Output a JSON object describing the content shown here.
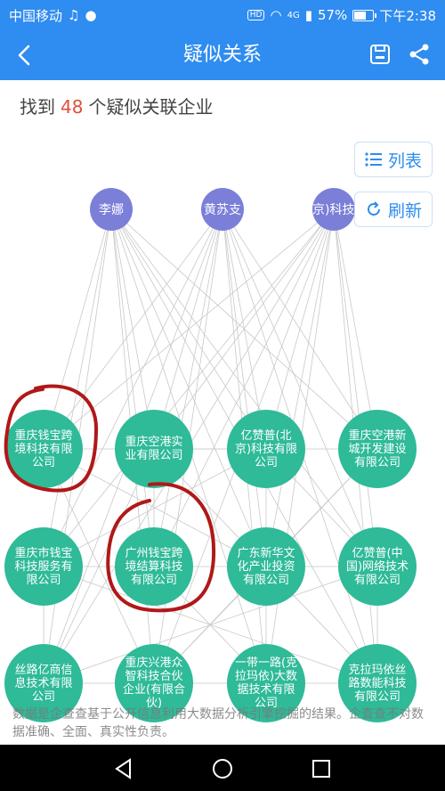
{
  "status": {
    "carrier": "中国移动",
    "signal": "4G",
    "battery": "57%",
    "battery_level": 0.57,
    "time": "下午2:38"
  },
  "header": {
    "title": "疑似关系",
    "icons": [
      "back-icon",
      "save-icon",
      "share-icon"
    ]
  },
  "summary": {
    "prefix": "找到",
    "count": "48",
    "suffix": "个疑似关联企业"
  },
  "toolbar": {
    "list_label": "列表",
    "refresh_label": "刷新"
  },
  "people": [
    {
      "name": "李娜"
    },
    {
      "name": "黄苏支"
    },
    {
      "name": "京)科技有"
    }
  ],
  "companies": [
    {
      "name": "重庆钱宝跨境科技有限公司"
    },
    {
      "name": "重庆空港实业有限公司"
    },
    {
      "name": "亿赞普(北京)科技有限公司"
    },
    {
      "name": "重庆空港新城开发建设有限公司"
    },
    {
      "name": "重庆市钱宝科技服务有限公司"
    },
    {
      "name": "广州钱宝跨境结算科技有限公司"
    },
    {
      "name": "广东新华文化产业投资有限公司"
    },
    {
      "name": "亿赞普(中国)网络技术有限公司"
    },
    {
      "name": "丝路亿商信息技术有限公司"
    },
    {
      "name": "重庆兴港众智科技合伙企业(有限合伙)"
    },
    {
      "name": "一带一路(克拉玛依)大数据技术有限公司"
    },
    {
      "name": "克拉玛依丝路数能科技有限公司"
    }
  ],
  "disclaimer": "数据是企查查基于公开信息利用大数据分析引擎挖掘的结果。企查查不对数据准确、全面、真实性负责。",
  "colors": {
    "accent": "#2f8cf0",
    "person": "#7b7fd8",
    "company": "#2fba98",
    "highlight_circle": "#b01818",
    "count": "#e0503c"
  }
}
